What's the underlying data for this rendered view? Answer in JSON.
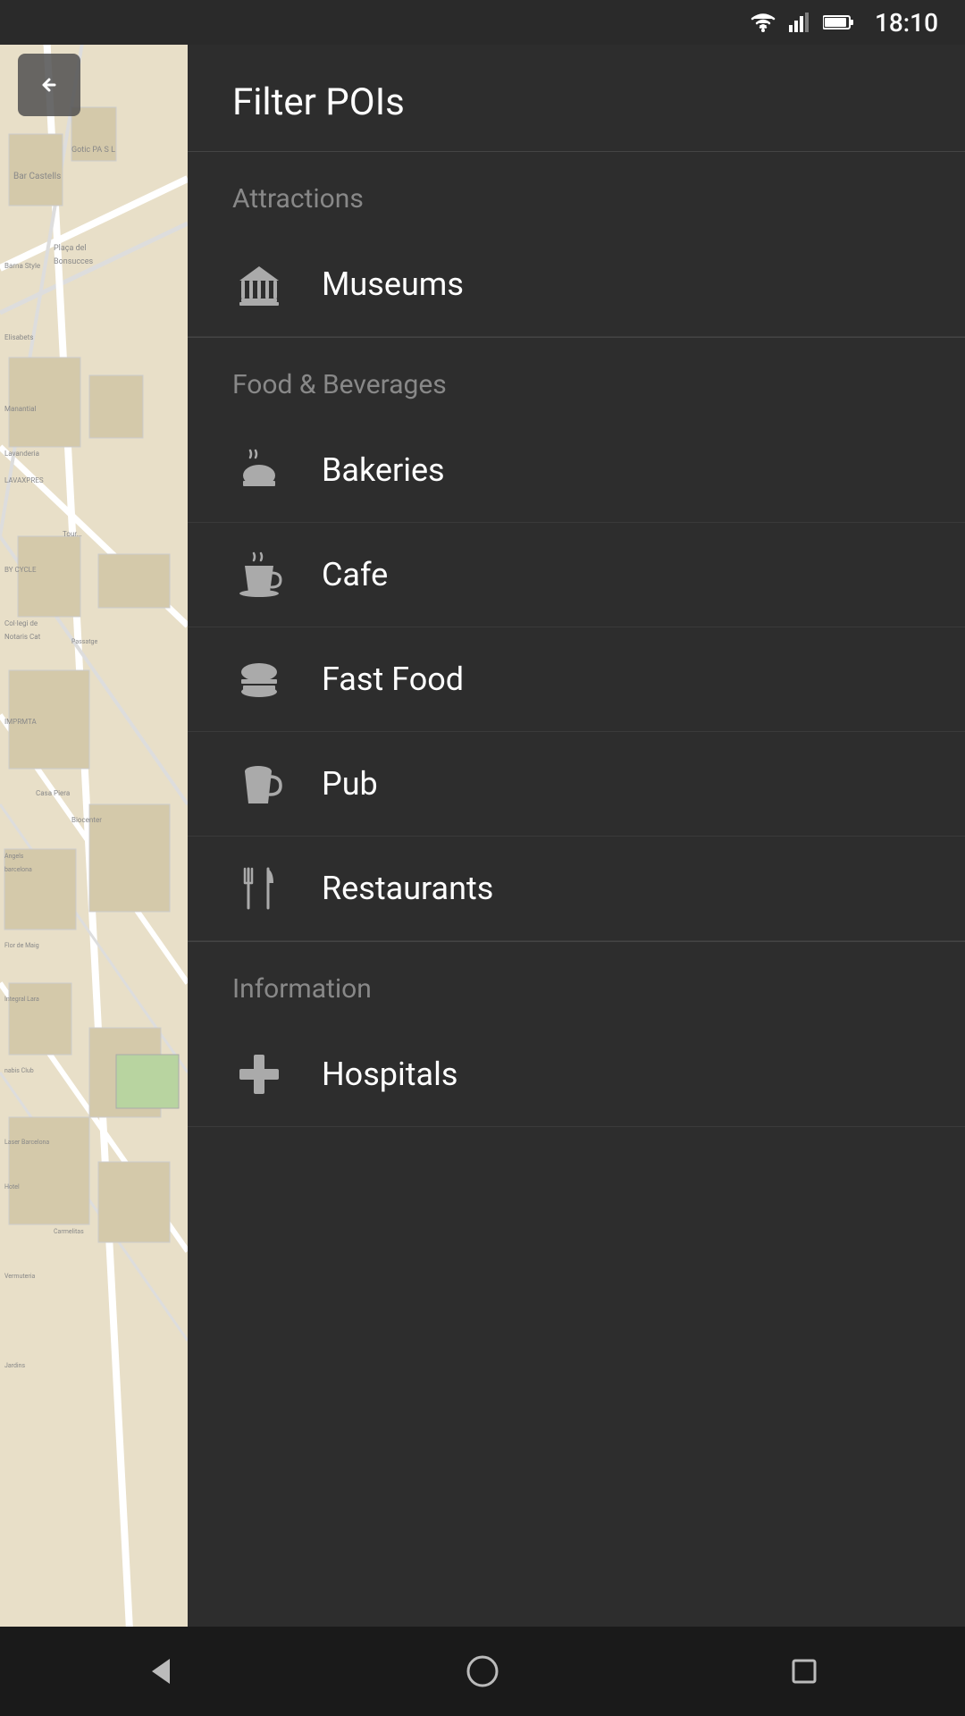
{
  "statusBar": {
    "time": "18:10"
  },
  "header": {
    "title": "Filter POIs"
  },
  "sections": [
    {
      "id": "attractions",
      "label": "Attractions",
      "items": [
        {
          "id": "museums",
          "label": "Museums",
          "icon": "museum-icon"
        }
      ]
    },
    {
      "id": "food-beverages",
      "label": "Food & Beverages",
      "items": [
        {
          "id": "bakeries",
          "label": "Bakeries",
          "icon": "bakery-icon"
        },
        {
          "id": "cafe",
          "label": "Cafe",
          "icon": "cafe-icon"
        },
        {
          "id": "fast-food",
          "label": "Fast Food",
          "icon": "fastfood-icon"
        },
        {
          "id": "pub",
          "label": "Pub",
          "icon": "pub-icon"
        },
        {
          "id": "restaurants",
          "label": "Restaurants",
          "icon": "restaurant-icon"
        }
      ]
    },
    {
      "id": "information",
      "label": "Information",
      "items": [
        {
          "id": "hospitals",
          "label": "Hospitals",
          "icon": "hospital-icon"
        }
      ]
    }
  ],
  "backButton": {
    "label": "back"
  },
  "nav": {
    "back": "◁",
    "home": "○",
    "recents": "□"
  }
}
